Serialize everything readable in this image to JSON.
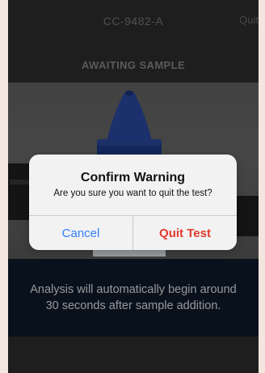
{
  "header": {
    "device_id": "CC-9482-A",
    "quit_label": "Quit"
  },
  "status": {
    "title": "AWAITING SAMPLE"
  },
  "info": {
    "text": "Analysis will automatically begin around 30 seconds after sample addition."
  },
  "dialog": {
    "title": "Confirm Warning",
    "message": "Are you sure you want to quit the test?",
    "cancel_label": "Cancel",
    "confirm_label": "Quit Test"
  },
  "colors": {
    "cancel": "#2f7ff6",
    "destructive": "#e23a2d",
    "info_band": "#0f1b2c"
  }
}
